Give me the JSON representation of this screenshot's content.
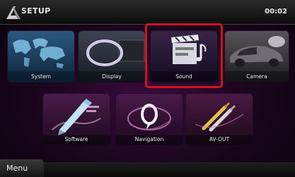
{
  "header": {
    "title": "SETUP",
    "time": "00:02"
  },
  "tiles": [
    {
      "id": "system",
      "label": "System",
      "icon": "world-map-icon"
    },
    {
      "id": "display",
      "label": "Display",
      "icon": "ring-icon"
    },
    {
      "id": "sound",
      "label": "Sound",
      "icon": "clapperboard-music-icon"
    },
    {
      "id": "camera",
      "label": "Camera",
      "icon": "car-camera-icon"
    },
    {
      "id": "software",
      "label": "Software",
      "icon": "pen-icon"
    },
    {
      "id": "navigation",
      "label": "Navigation",
      "icon": "navigation-swirl-icon"
    },
    {
      "id": "avout",
      "label": "AV-OUT",
      "icon": "av-cable-icon"
    }
  ],
  "footer": {
    "menu_label": "Menu"
  },
  "colors": {
    "highlight": "#d4121c",
    "background": "#1c0620"
  }
}
